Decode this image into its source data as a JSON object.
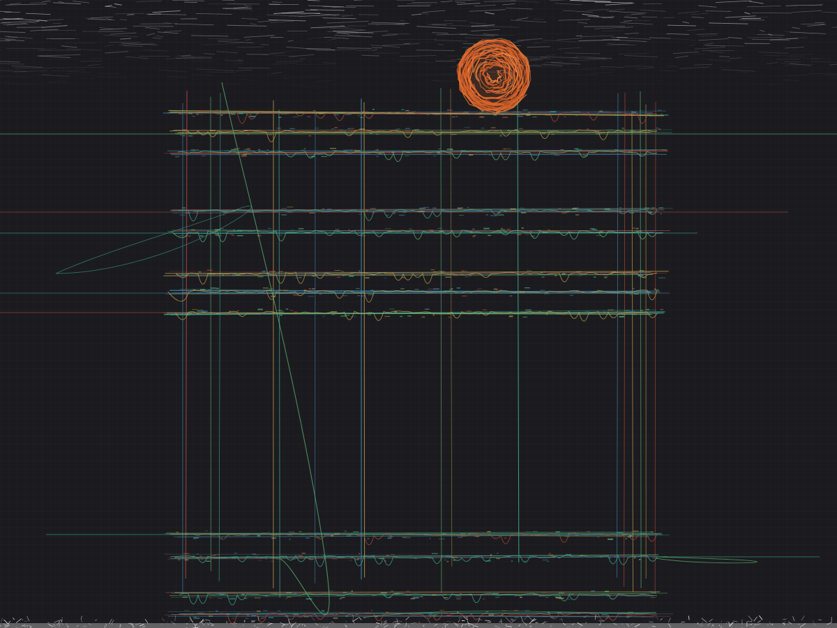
{
  "artwork": {
    "subject": "glitch-line-drawing",
    "colors": {
      "background": "#1b1b1f",
      "grid": "#26262b",
      "sky_scratches": "#d9d9d9",
      "sun": "#e0662a",
      "sun_highlight": "#f08a45",
      "teal": "#3aa88a",
      "green": "#5fb070",
      "blue": "#3f7fa8",
      "red": "#b0483a",
      "ochre": "#b99a4a",
      "ground_scratches": "#e8e8e8"
    }
  }
}
